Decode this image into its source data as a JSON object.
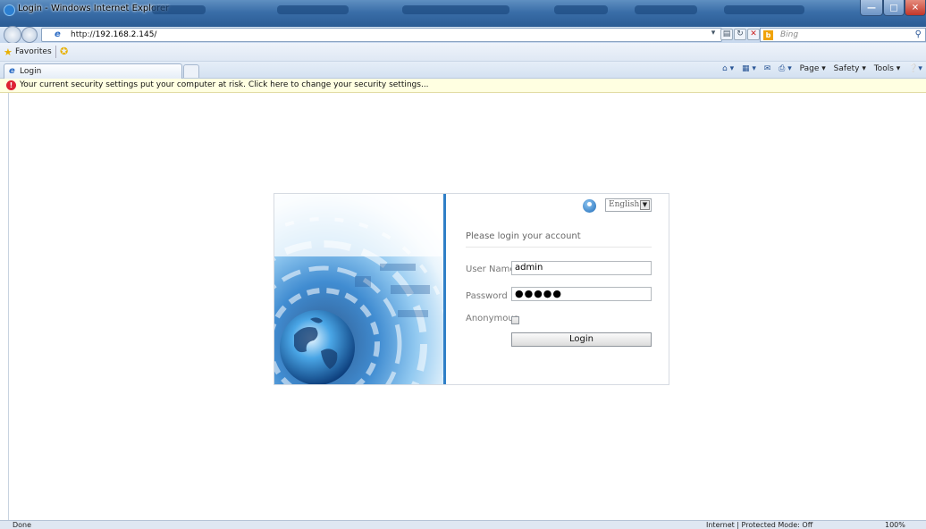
{
  "window": {
    "title": "Login - Windows Internet Explorer"
  },
  "addressbar": {
    "url_prefix": "http://",
    "url_host": "192.168.2.145/"
  },
  "search": {
    "placeholder": "Bing"
  },
  "favorites": {
    "label": "Favorites"
  },
  "tabs": [
    {
      "label": "Login"
    }
  ],
  "commandbar": {
    "page": "Page ▾",
    "safety": "Safety ▾",
    "tools": "Tools ▾"
  },
  "infobar": {
    "message": "Your current security settings put your computer at risk. Click here to change your security settings..."
  },
  "login": {
    "language": "English",
    "prompt": "Please login your account",
    "username_label": "User Name",
    "username_value": "admin",
    "password_label": "Password",
    "password_value": "●●●●●",
    "anonymous_label": "Anonymous",
    "login_button": "Login"
  },
  "statusbar": {
    "status": "Done",
    "zone": "Internet | Protected Mode: Off",
    "zoom": "100%"
  },
  "colors": {
    "accent_divider": "#2f7fc7",
    "infobar_bg": "#ffffe1",
    "titlebar": "#3a6ea8"
  }
}
